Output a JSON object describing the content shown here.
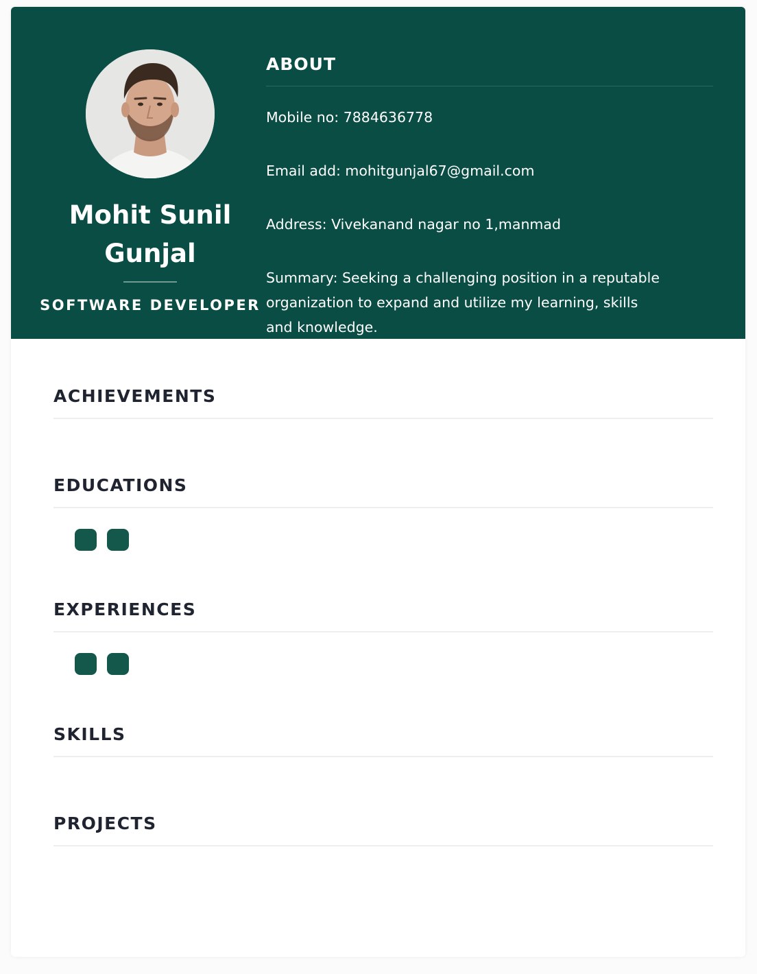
{
  "profile": {
    "name": "Mohit Sunil Gunjal",
    "title": "SOFTWARE DEVELOPER",
    "photo_alt": "profile photo"
  },
  "about": {
    "heading": "ABOUT",
    "mobile": "Mobile no: 7884636778",
    "email": "Email add: mohitgunjal67@gmail.com",
    "address": "Address: Vivekanand nagar no 1,manmad",
    "summary": "Summary: Seeking a challenging position in a reputable organization to expand and utilize my learning, skills and knowledge."
  },
  "sections": {
    "achievements": "ACHIEVEMENTS",
    "educations": "EDUCATIONS",
    "experiences": "EXPERIENCES",
    "skills": "SKILLS",
    "projects": "PROJECTS"
  },
  "colors": {
    "header_bg": "#094d44",
    "chip": "#14574b",
    "heading_text": "#1f2430"
  }
}
